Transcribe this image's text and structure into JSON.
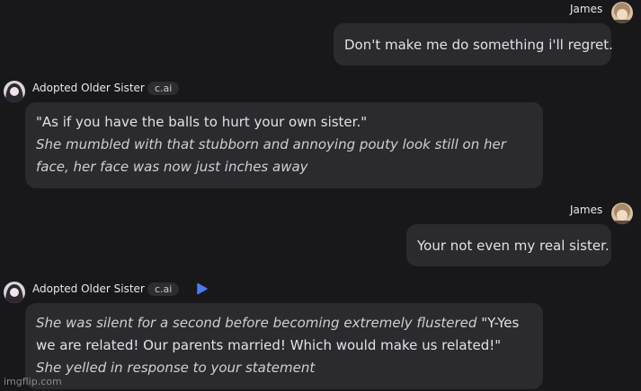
{
  "messages": [
    {
      "sender": "James",
      "text": "Don't make me do something i'll regret."
    },
    {
      "sender": "Adopted Older Sister",
      "tag": "c.ai",
      "line1": "\"As if you have the balls to hurt your own sister.\"",
      "line2": "She mumbled with that stubborn and annoying pouty look still on her face, her face was now just inches away"
    },
    {
      "sender": "James",
      "text": "Your not even my real sister."
    },
    {
      "sender": "Adopted Older Sister",
      "tag": "c.ai",
      "italic1": "She was silent for a second before becoming extremely flustered",
      "speech": " \"Y-Yes we are related! Our parents married! Which would make us related!\"",
      "italic2": "She yelled in response to your statement"
    }
  ],
  "icons": {
    "play": "play-icon",
    "avatar_user": "avatar",
    "avatar_char": "avatar"
  },
  "watermark": "imgflip.com",
  "colors": {
    "background": "#18181b",
    "bubble": "#2a2a2f",
    "accent": "#4a7cf0"
  }
}
